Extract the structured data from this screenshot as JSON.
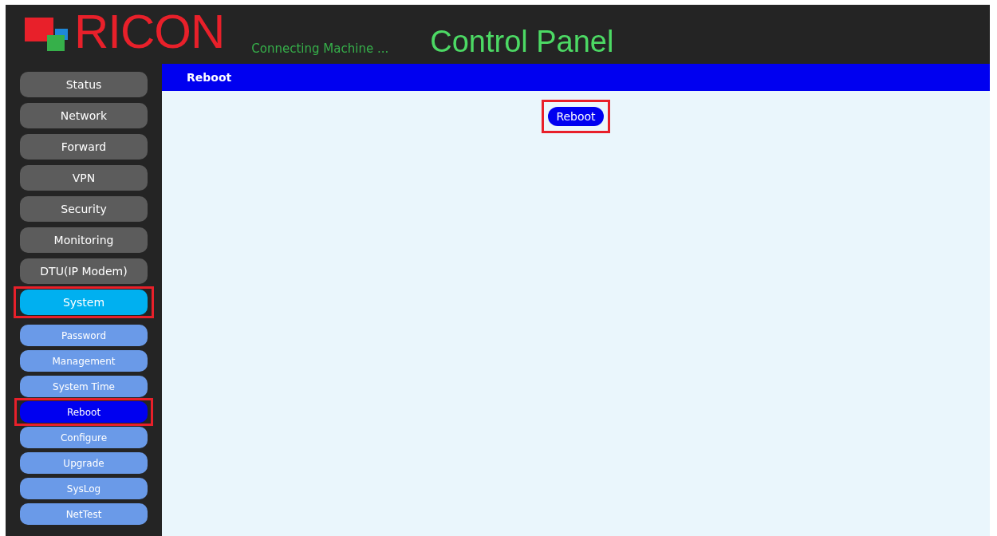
{
  "header": {
    "logo": "RICON",
    "tagline": "Connecting Machine ...",
    "title": "Control Panel"
  },
  "menu": [
    {
      "label": "Status",
      "selected": false,
      "highlighted": false
    },
    {
      "label": "Network",
      "selected": false,
      "highlighted": false
    },
    {
      "label": "Forward",
      "selected": false,
      "highlighted": false
    },
    {
      "label": "VPN",
      "selected": false,
      "highlighted": false
    },
    {
      "label": "Security",
      "selected": false,
      "highlighted": false
    },
    {
      "label": "Monitoring",
      "selected": false,
      "highlighted": false
    },
    {
      "label": "DTU(IP Modem)",
      "selected": false,
      "highlighted": false
    },
    {
      "label": "System",
      "selected": true,
      "highlighted": true
    }
  ],
  "submenu": [
    {
      "label": "Password",
      "selected": false,
      "highlighted": false
    },
    {
      "label": "Management",
      "selected": false,
      "highlighted": false
    },
    {
      "label": "System Time",
      "selected": false,
      "highlighted": false
    },
    {
      "label": "Reboot",
      "selected": true,
      "highlighted": true
    },
    {
      "label": "Configure",
      "selected": false,
      "highlighted": false
    },
    {
      "label": "Upgrade",
      "selected": false,
      "highlighted": false
    },
    {
      "label": "SysLog",
      "selected": false,
      "highlighted": false
    },
    {
      "label": "NetTest",
      "selected": false,
      "highlighted": false
    }
  ],
  "page": {
    "title": "Reboot",
    "button": {
      "label": "Reboot",
      "highlighted": true
    }
  }
}
